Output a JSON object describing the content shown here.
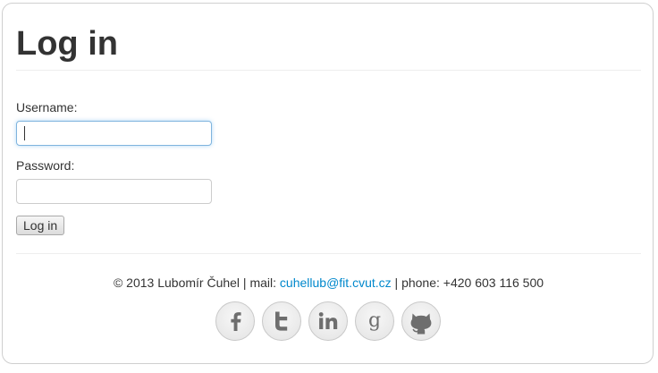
{
  "page": {
    "title": "Log in"
  },
  "form": {
    "username_label": "Username:",
    "username_value": "",
    "password_label": "Password:",
    "password_value": "",
    "submit_label": "Log in"
  },
  "footer": {
    "copyright": "© 2013 Lubomír Čuhel",
    "separator": " | ",
    "mail_prefix": "mail: ",
    "mail_link": "cuhellub@fit.cvut.cz",
    "phone": "phone: +420 603 116 500"
  },
  "social": [
    {
      "icon": "facebook-icon"
    },
    {
      "icon": "twitter-icon"
    },
    {
      "icon": "linkedin-icon"
    },
    {
      "icon": "google-icon"
    },
    {
      "icon": "github-icon"
    }
  ],
  "colors": {
    "link": "#0088cc",
    "text": "#333333",
    "icon": "#6e6e6e",
    "focus_border": "#7fb4de"
  }
}
